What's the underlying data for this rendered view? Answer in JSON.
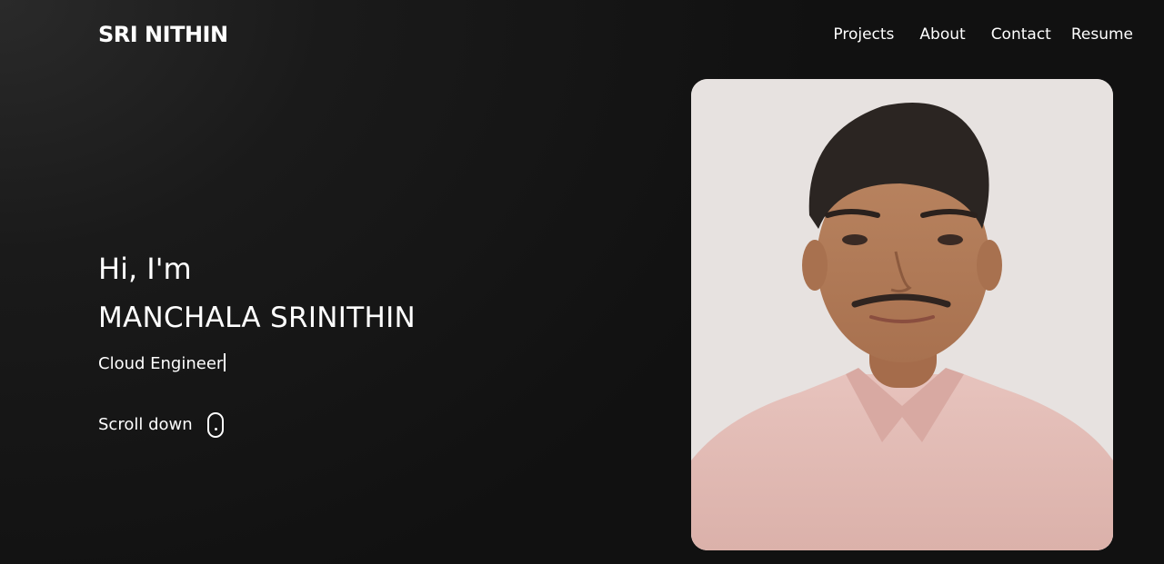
{
  "header": {
    "brand": "SRI NITHIN",
    "nav": [
      {
        "label": "Projects"
      },
      {
        "label": "About"
      },
      {
        "label": "Contact"
      },
      {
        "label": "Resume"
      }
    ]
  },
  "hero": {
    "greeting": "Hi, I'm",
    "name": "MANCHALA SRINITHIN",
    "role": "Cloud Engineer",
    "scroll_label": "Scroll down",
    "scroll_icon": "mouse-icon",
    "photo_icon": "profile-photo"
  },
  "colors": {
    "background": "#141414",
    "text": "#ffffff"
  }
}
